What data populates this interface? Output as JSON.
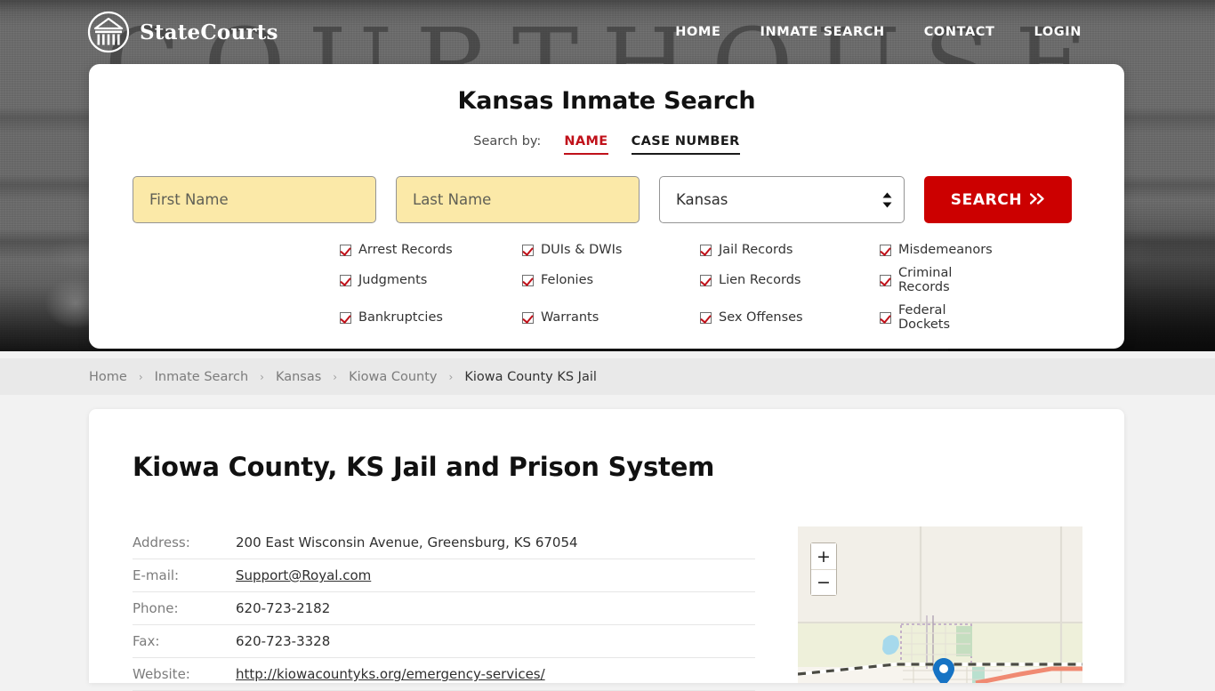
{
  "header": {
    "brand_name": "StateCourts",
    "logo_icon": "courthouse-circle-icon",
    "background_word": "COURTHOUSE",
    "nav": [
      {
        "label": "HOME"
      },
      {
        "label": "INMATE SEARCH"
      },
      {
        "label": "CONTACT"
      },
      {
        "label": "LOGIN"
      }
    ]
  },
  "search_card": {
    "title": "Kansas Inmate Search",
    "search_by_label": "Search by:",
    "tabs": [
      {
        "label": "NAME",
        "active": true
      },
      {
        "label": "CASE NUMBER",
        "active": false
      }
    ],
    "first_name_placeholder": "First Name",
    "first_name_value": "",
    "last_name_placeholder": "Last Name",
    "last_name_value": "",
    "state_selected": "Kansas",
    "state_options": [
      "Kansas"
    ],
    "search_button_label": "SEARCH",
    "search_button_icon": "double-chevron-right-icon",
    "accent_color": "#cc0000",
    "field_fill_color": "#fbe9a8",
    "checkbox_check_color": "#c0111a",
    "record_types": [
      "Arrest Records",
      "DUIs & DWIs",
      "Jail Records",
      "Misdemeanors",
      "Judgments",
      "Felonies",
      "Lien Records",
      "Criminal Records",
      "Bankruptcies",
      "Warrants",
      "Sex Offenses",
      "Federal Dockets"
    ]
  },
  "breadcrumb": {
    "separator": "›",
    "items": [
      {
        "label": "Home",
        "current": false
      },
      {
        "label": "Inmate Search",
        "current": false
      },
      {
        "label": "Kansas",
        "current": false
      },
      {
        "label": "Kiowa County",
        "current": false
      },
      {
        "label": "Kiowa County KS Jail",
        "current": true
      }
    ]
  },
  "main": {
    "page_title": "Kiowa County, KS Jail and Prison System",
    "info_rows": [
      {
        "key": "Address:",
        "value": "200 East Wisconsin Avenue, Greensburg, KS 67054",
        "link": false
      },
      {
        "key": "E-mail:",
        "value": "Support@Royal.com",
        "link": true
      },
      {
        "key": "Phone:",
        "value": "620-723-2182",
        "link": false
      },
      {
        "key": "Fax:",
        "value": "620-723-3328",
        "link": false
      },
      {
        "key": "Website:",
        "value": "http://kiowacountyks.org/emergency-services/",
        "link": true
      }
    ]
  },
  "map": {
    "zoom_in_label": "+",
    "zoom_out_label": "−",
    "zoom_in_icon": "plus-icon",
    "zoom_out_icon": "minus-icon",
    "marker_icon": "location-pin-icon"
  }
}
